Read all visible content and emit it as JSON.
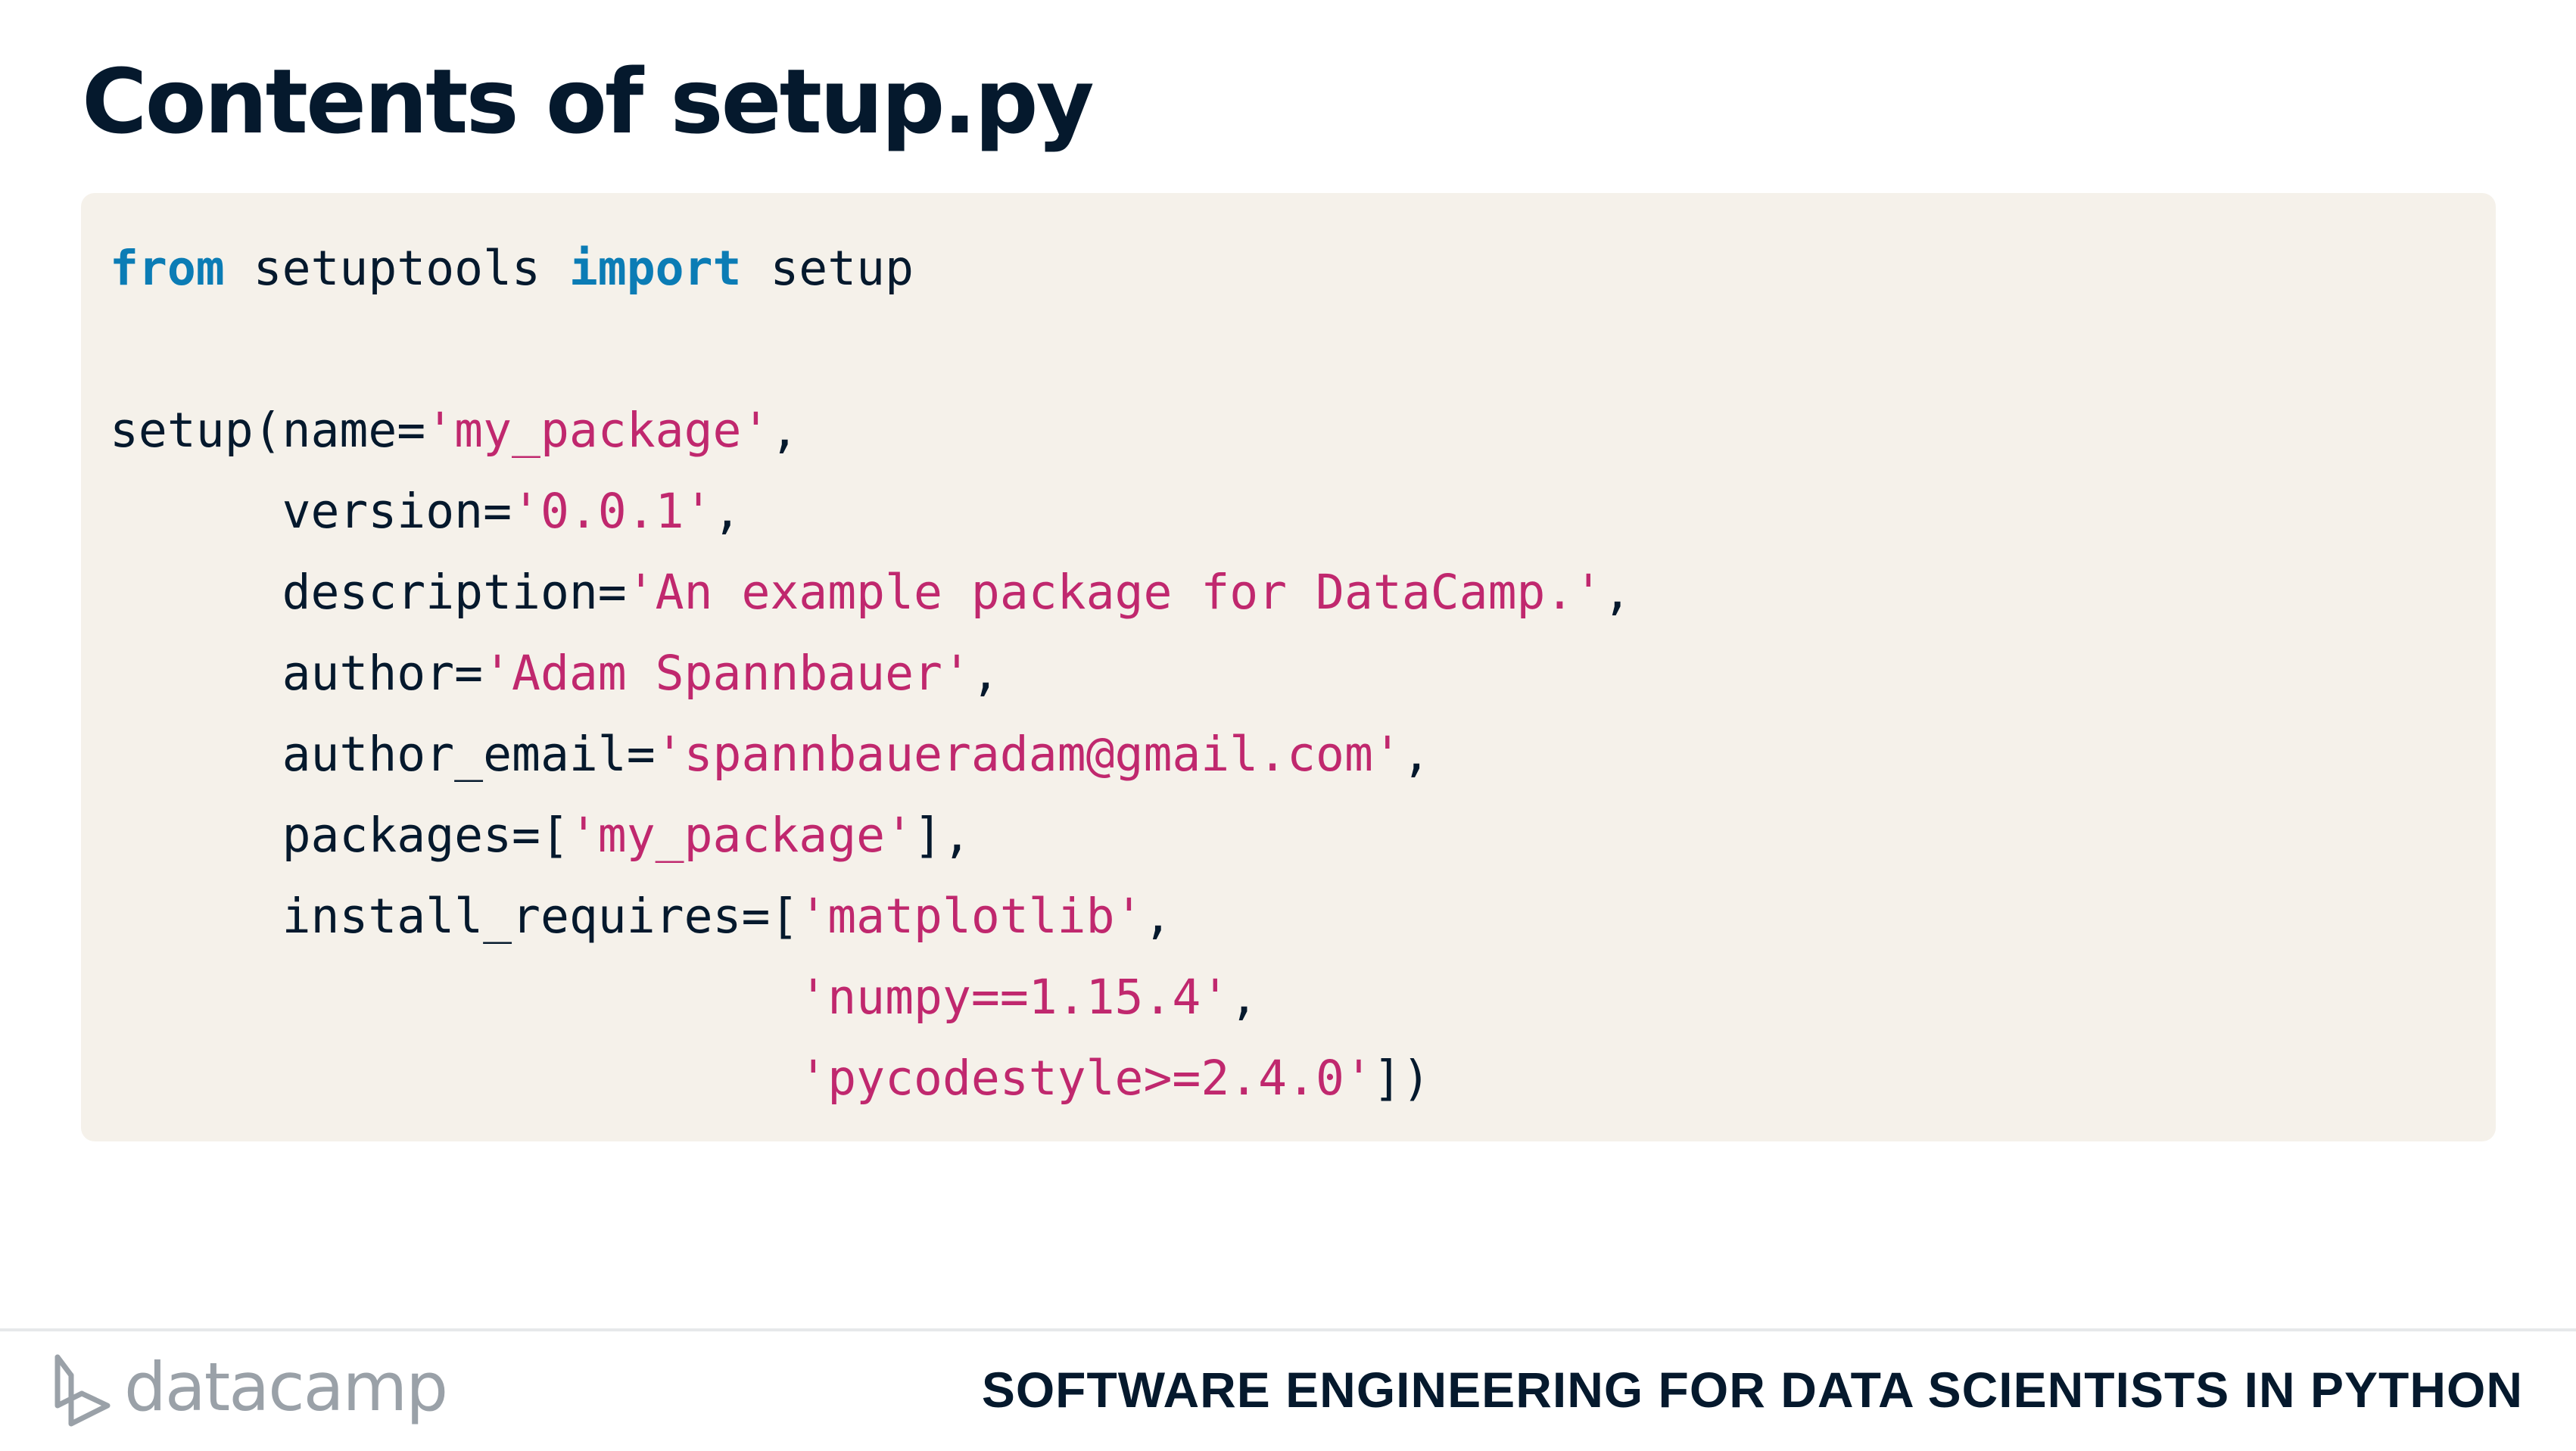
{
  "slide": {
    "title": "Contents of setup.py"
  },
  "code": {
    "language": "python",
    "lines": [
      [
        {
          "kind": "kw",
          "text": "from"
        },
        {
          "kind": "plain",
          "text": " setuptools "
        },
        {
          "kind": "kw",
          "text": "import"
        },
        {
          "kind": "plain",
          "text": " setup"
        }
      ],
      [],
      [
        {
          "kind": "plain",
          "text": "setup(name="
        },
        {
          "kind": "str",
          "text": "'my_package'"
        },
        {
          "kind": "plain",
          "text": ","
        }
      ],
      [
        {
          "kind": "plain",
          "text": "      version="
        },
        {
          "kind": "str",
          "text": "'0.0.1'"
        },
        {
          "kind": "plain",
          "text": ","
        }
      ],
      [
        {
          "kind": "plain",
          "text": "      description="
        },
        {
          "kind": "str",
          "text": "'An example package for DataCamp.'"
        },
        {
          "kind": "plain",
          "text": ","
        }
      ],
      [
        {
          "kind": "plain",
          "text": "      author="
        },
        {
          "kind": "str",
          "text": "'Adam Spannbauer'"
        },
        {
          "kind": "plain",
          "text": ","
        }
      ],
      [
        {
          "kind": "plain",
          "text": "      author_email="
        },
        {
          "kind": "str",
          "text": "'spannbaueradam@gmail.com'"
        },
        {
          "kind": "plain",
          "text": ","
        }
      ],
      [
        {
          "kind": "plain",
          "text": "      packages=["
        },
        {
          "kind": "str",
          "text": "'my_package'"
        },
        {
          "kind": "plain",
          "text": "],"
        }
      ],
      [
        {
          "kind": "plain",
          "text": "      install_requires=["
        },
        {
          "kind": "str",
          "text": "'matplotlib'"
        },
        {
          "kind": "plain",
          "text": ","
        }
      ],
      [
        {
          "kind": "plain",
          "text": "                        "
        },
        {
          "kind": "str",
          "text": "'numpy==1.15.4'"
        },
        {
          "kind": "plain",
          "text": ","
        }
      ],
      [
        {
          "kind": "plain",
          "text": "                        "
        },
        {
          "kind": "str",
          "text": "'pycodestyle>=2.4.0'"
        },
        {
          "kind": "plain",
          "text": "])"
        }
      ]
    ]
  },
  "footer": {
    "logo_text": "datacamp",
    "logo_icon": "datacamp-logo-icon",
    "course_name": "SOFTWARE ENGINEERING FOR DATA SCIENTISTS IN PYTHON"
  },
  "colors": {
    "title": "#05192d",
    "code_background": "#f5f1ea",
    "keyword": "#0b7cb5",
    "string": "#c0286e",
    "plain": "#05192d",
    "logo": "#9aa1a8"
  }
}
